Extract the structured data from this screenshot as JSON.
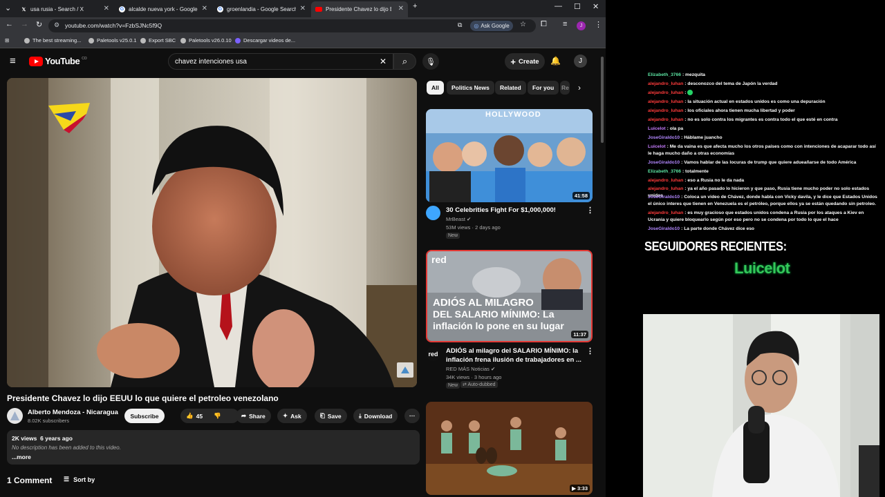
{
  "tabs": [
    {
      "title": "usa rusia - Search / X",
      "icon": "x-logo-icon"
    },
    {
      "title": "alcalde nueva york - Google Search",
      "icon": "google-icon"
    },
    {
      "title": "groenlandia - Google Search",
      "icon": "google-icon"
    },
    {
      "title": "Presidente Chavez lo dijo EEUU lo que quiere el petroleo venezolano",
      "icon": "youtube-icon"
    }
  ],
  "toolbar": {
    "url": "youtube.com/watch?v=FzbSJNc5f9Q",
    "ask_google": "Ask Google",
    "profile_initial": "J"
  },
  "bookmarks": [
    "The best streaming...",
    "Paletools v25.0.1",
    "Export SBC",
    "Paletools v26.0.10",
    "Descargar videos de..."
  ],
  "youtube": {
    "logo_text": "YouTube",
    "country_code": "CO",
    "search_value": "chavez intenciones usa",
    "create_label": "Create",
    "avatar_initial": "J"
  },
  "video": {
    "title": "Presidente Chavez lo dijo EEUU lo que quiere el petroleo venezolano",
    "channel": "Alberto Mendoza - Nicaragua",
    "subscribers": "8.02K subscribers",
    "subscribe_label": "Subscribe",
    "likes": "45",
    "share_label": "Share",
    "ask_label": "Ask",
    "save_label": "Save",
    "download_label": "Download",
    "views": "2K views",
    "age": "6 years ago",
    "description": "No description has been added to this video.",
    "more_label": "...more",
    "comments_count": "1 Comment",
    "sort_label": "Sort by"
  },
  "chips": [
    "All",
    "Politics News",
    "Related",
    "For you",
    "Re"
  ],
  "recommendations": [
    {
      "title": "30 Celebrities Fight For $1,000,000!",
      "channel": "MrBeast",
      "meta": "53M views · 2 days ago",
      "tag": "New",
      "duration": "41:58",
      "thumb_banner": "HOLLYWOOD"
    },
    {
      "title": "ADIÓS al milagro del SALARIO MÍNIMO: la inflación frena ilusión de trabajadores en ...",
      "channel": "RED MÁS Noticias",
      "meta": "34K views · 3 hours ago",
      "tag": "New",
      "tag2": "Auto-dubbed",
      "duration": "11:37",
      "thumb_logo": "red",
      "thumb_line1": "ADIÓS AL MILAGRO",
      "thumb_line2": "DEL SALARIO MÍNIMO: La",
      "thumb_line3": "inflación lo pone en su lugar"
    },
    {
      "title": "",
      "duration": "3:33"
    }
  ],
  "chat": [
    {
      "user": "Elizabeth_3766",
      "color": "#5be3a2",
      "msg": "mezquita"
    },
    {
      "user": "alejandro_luhan",
      "color": "#ff3b3b",
      "msg": "desconozco del tema de Japón la verdad"
    },
    {
      "user": "alejandro_luhan",
      "color": "#ff3b3b",
      "msg": "",
      "emoji": true
    },
    {
      "user": "alejandro_luhan",
      "color": "#ff3b3b",
      "msg": "la situación actual en estados unidos es como una depuración"
    },
    {
      "user": "alejandro_luhan",
      "color": "#ff3b3b",
      "msg": "los oficiales ahora tienen mucha libertad y poder"
    },
    {
      "user": "alejandro_luhan",
      "color": "#ff3b3b",
      "msg": "no es solo contra los migrantes es contra todo el que esté en contra"
    },
    {
      "user": "Luicelot",
      "color": "#c77dff",
      "msg": "ola pa"
    },
    {
      "user": "JoseGiraldo10",
      "color": "#b388ff",
      "msg": "Háblame juancho"
    },
    {
      "user": "Luicelot",
      "color": "#c77dff",
      "msg": "Me da vaina es que afecta mucho los otros países como con intenciones de acaparar todo así le haga mucho daño a otras economías"
    },
    {
      "user": "JoseGiraldo10",
      "color": "#b388ff",
      "msg": "Vamos hablar de las locuras de trump que quiere adueañarse de todo América"
    },
    {
      "user": "Elizabeth_3766",
      "color": "#5be3a2",
      "msg": "totalmente"
    },
    {
      "user": "alejandro_luhan",
      "color": "#ff3b3b",
      "msg": "eso a Rusia no le da nada"
    },
    {
      "user": "alejandro_luhan",
      "color": "#ff3b3b",
      "msg": "ya el año pasado lo hicieron y que paso, Rusia tiene mucho poder no solo estados unidos"
    },
    {
      "user": "JoseGiraldo10",
      "color": "#b388ff",
      "msg": "Coloca un video de Chávez, donde habla con Vicky davila, y le dice que Estados Unidos el único interes que tienen en Venezuela es el petróleo, porque ellos ya se están quedando sin petroleo."
    },
    {
      "user": "alejandro_luhan",
      "color": "#ff3b3b",
      "msg": "es muy gracioso que estados unidos condena a Rusia por los ataques a Kiev en Ucrania y quiere bloquearlo según por eso pero no se condena por todo lo que el hace"
    },
    {
      "user": "JoseGiraldo10",
      "color": "#b388ff",
      "msg": "La parte donde Chávez dice eso"
    }
  ],
  "stream": {
    "followers_title": "SEGUIDORES RECIENTES:",
    "latest_follower": "Luicelot"
  }
}
